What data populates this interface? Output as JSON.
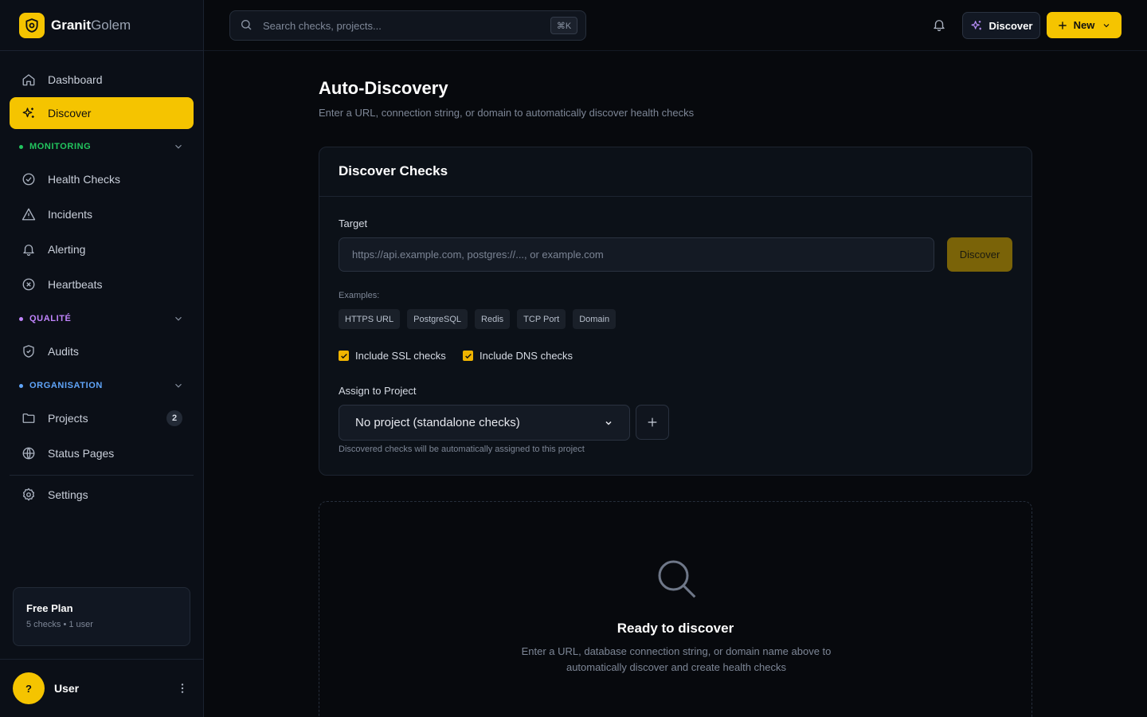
{
  "brand": {
    "name_bold": "Granit",
    "name_light": "Golem"
  },
  "sidebar": {
    "top_items": [
      {
        "label": "Dashboard",
        "icon": "home-icon"
      },
      {
        "label": "Discover",
        "icon": "sparkles-icon",
        "active": true
      }
    ],
    "sections": {
      "monitoring": {
        "label": "MONITORING",
        "color": "#22c55e",
        "items": [
          {
            "label": "Health Checks",
            "icon": "check-circle-icon"
          },
          {
            "label": "Incidents",
            "icon": "warning-triangle-icon"
          },
          {
            "label": "Alerting",
            "icon": "bell-icon"
          },
          {
            "label": "Heartbeats",
            "icon": "x-circle-icon"
          }
        ]
      },
      "qualite": {
        "label": "QUALITÉ",
        "color": "#c084fc",
        "items": [
          {
            "label": "Audits",
            "icon": "shield-check-icon"
          }
        ]
      },
      "organisation": {
        "label": "ORGANISATION",
        "color": "#60a5fa",
        "items": [
          {
            "label": "Projects",
            "icon": "folder-icon",
            "badge": "2"
          },
          {
            "label": "Status Pages",
            "icon": "globe-icon"
          }
        ]
      }
    },
    "settings": {
      "label": "Settings",
      "icon": "gear-icon"
    },
    "plan": {
      "title": "Free Plan",
      "subtitle": "5 checks • 1 user"
    },
    "user": {
      "avatar": "?",
      "name": "User"
    }
  },
  "topbar": {
    "search": {
      "placeholder": "Search checks, projects...",
      "shortcut": "⌘K"
    },
    "discover_label": "Discover",
    "new_label": "New"
  },
  "page": {
    "title": "Auto-Discovery",
    "subtitle": "Enter a URL, connection string, or domain to automatically discover health checks"
  },
  "card": {
    "title": "Discover Checks",
    "target_label": "Target",
    "target_placeholder": "https://api.example.com, postgres://..., or example.com",
    "target_value": "",
    "discover_label": "Discover",
    "examples_label": "Examples:",
    "examples": [
      "HTTPS URL",
      "PostgreSQL",
      "Redis",
      "TCP Port",
      "Domain"
    ],
    "ssl_label": "Include SSL checks",
    "ssl_checked": true,
    "dns_label": "Include DNS checks",
    "dns_checked": true,
    "project_label": "Assign to Project",
    "project_selected": "No project (standalone checks)",
    "project_hint": "Discovered checks will be automatically assigned to this project"
  },
  "empty_state": {
    "title": "Ready to discover",
    "text": "Enter a URL, database connection string, or domain name above to automatically discover and create health checks"
  },
  "colors": {
    "accent": "#f5c400",
    "background": "#07090d",
    "sidebar": "#0b0f17"
  }
}
